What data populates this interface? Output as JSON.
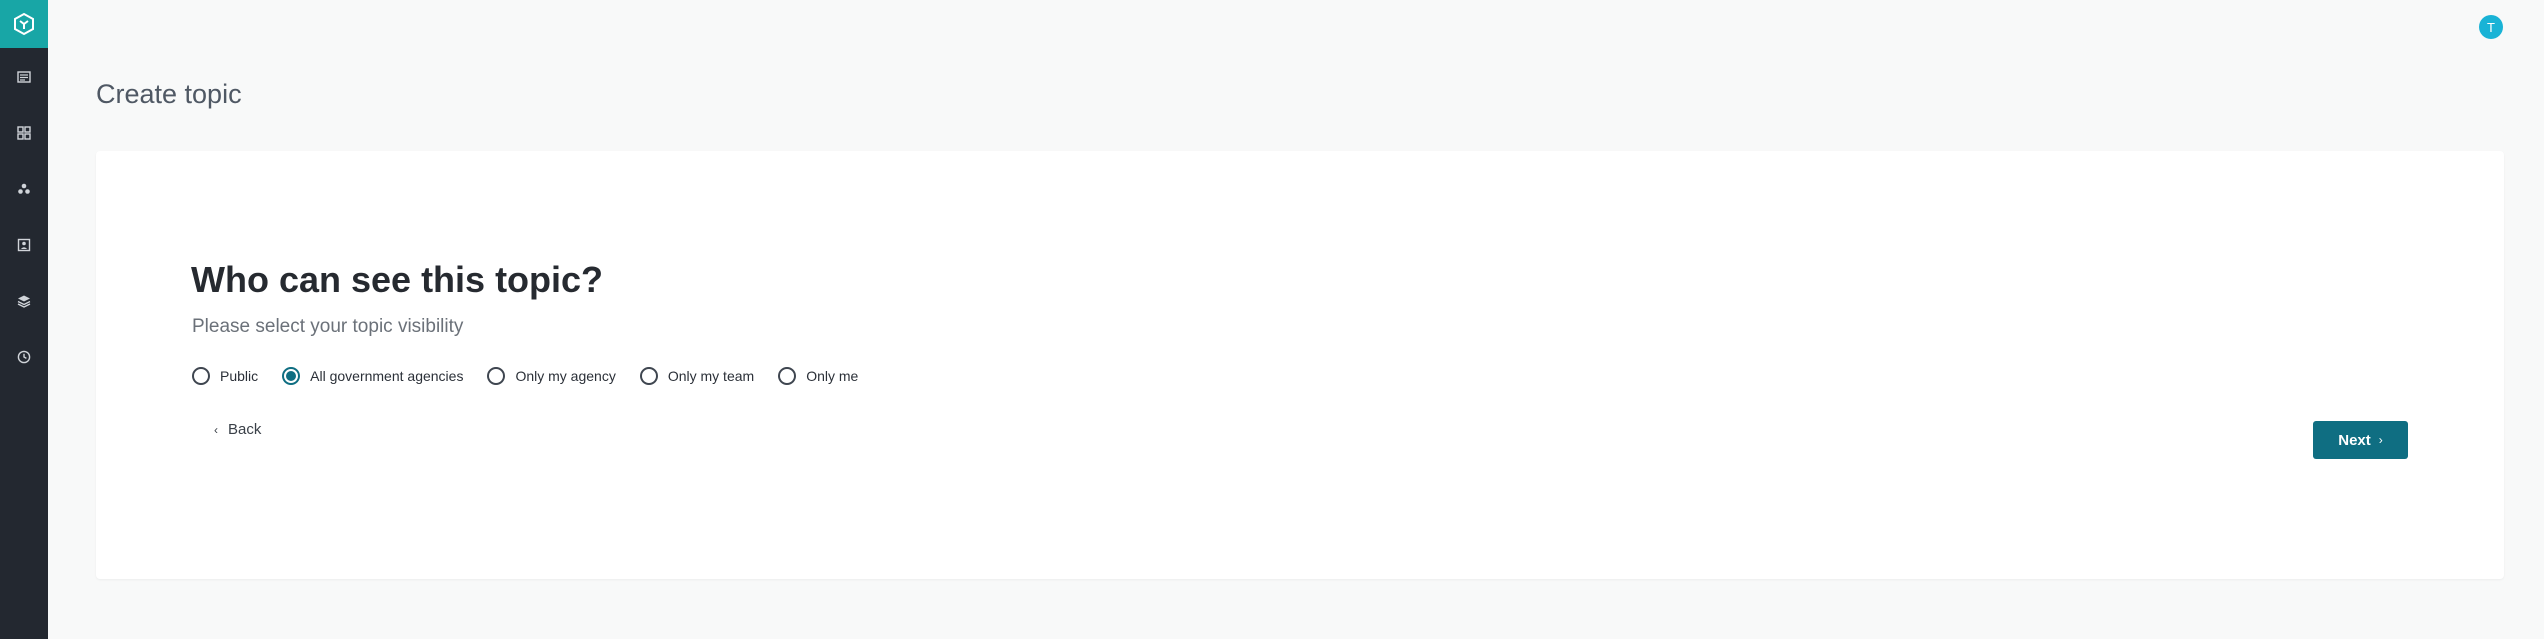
{
  "header": {
    "avatar_initial": "T"
  },
  "sidebar": {
    "items": [
      {
        "icon": "newspaper-icon"
      },
      {
        "icon": "grid-icon"
      },
      {
        "icon": "people-icon"
      },
      {
        "icon": "contact-card-icon"
      },
      {
        "icon": "layers-icon"
      },
      {
        "icon": "clock-icon"
      }
    ]
  },
  "page": {
    "title": "Create topic"
  },
  "form": {
    "question": "Who can see this topic?",
    "subtitle": "Please select your topic visibility",
    "options": [
      {
        "label": "Public",
        "selected": false
      },
      {
        "label": "All government agencies",
        "selected": true
      },
      {
        "label": "Only my agency",
        "selected": false
      },
      {
        "label": "Only my team",
        "selected": false
      },
      {
        "label": "Only me",
        "selected": false
      }
    ],
    "back_label": "Back",
    "next_label": "Next"
  },
  "colors": {
    "primary": "#0f6e82",
    "sidebar_bg": "#232830",
    "logo_bg": "#18a6a6",
    "avatar_bg": "#19b3d6",
    "page_bg": "#f8f9f9"
  }
}
